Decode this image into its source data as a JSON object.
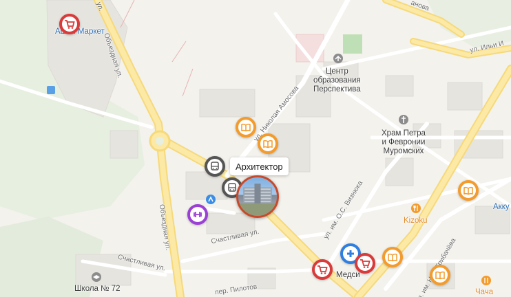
{
  "map": {
    "callout_title": "Архитектор",
    "pois": [
      {
        "name": "Ашан Маркет",
        "label": "Ашан Маркет"
      },
      {
        "name": "Центр образования Перспектива",
        "label_lines": [
          "Центр",
          "образования",
          "Перспектива"
        ]
      },
      {
        "name": "Храм Петра и Февронии Муромских",
        "label_lines": [
          "Храм Петра",
          "и Февронии",
          "Муромских"
        ]
      },
      {
        "name": "Школа № 72",
        "label": "Школа № 72"
      },
      {
        "name": "Kizoku",
        "label": "Kizoku"
      },
      {
        "name": "Медси",
        "label": "Медси"
      },
      {
        "name": "Чача",
        "label": "Чача"
      },
      {
        "name": "Аккуна",
        "label": "Акку"
      }
    ],
    "streets": {
      "obezdnaya_top": "Объездная ул.",
      "obezdnaya_bottom": "Объездная ул.",
      "obezdnaya_short": "ул.",
      "amosova": "ул. Николая Амосова",
      "vyaznikova": "ул. им. О.С. Визнюка",
      "gribacheva": "ул. им. Н.М. Грибачёва",
      "schastlivaya_1": "Счастливая ул.",
      "schastlivaya_2": "Счастливая ул.",
      "ilyi": "ул. Ильи И",
      "pilotov": "пер. Пилотов",
      "anova": "анова"
    }
  }
}
